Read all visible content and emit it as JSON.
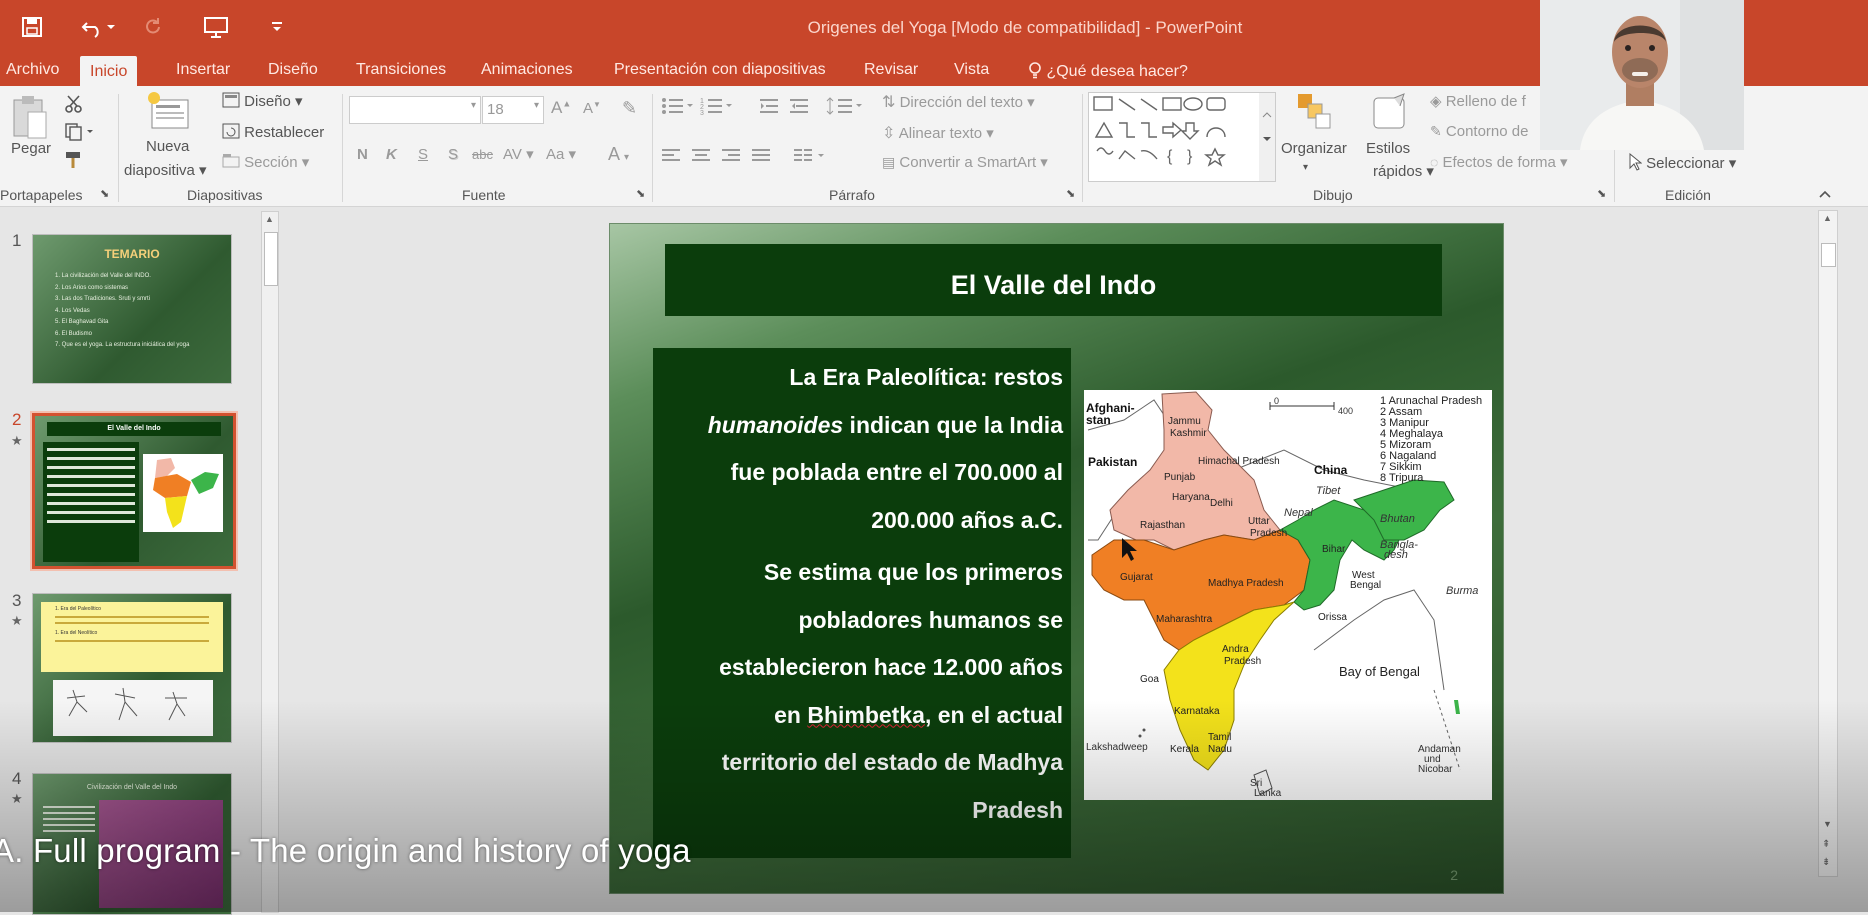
{
  "window": {
    "title": "Origenes del Yoga [Modo de compatibilidad] - PowerPoint"
  },
  "quick_access": {
    "save_icon": "save-icon",
    "undo_icon": "undo-icon",
    "redo_icon": "redo-icon",
    "present_icon": "presentation-icon",
    "customize_icon": "customize-qat-icon"
  },
  "tabs": [
    "Archivo",
    "Inicio",
    "Insertar",
    "Diseño",
    "Transiciones",
    "Animaciones",
    "Presentación con diapositivas",
    "Revisar",
    "Vista",
    "¿Qué desea hacer?"
  ],
  "active_tab": "Inicio",
  "ribbon": {
    "portapapeles": {
      "label": "Portapapeles",
      "pegar": "Pegar"
    },
    "diapositivas": {
      "label": "Diapositivas",
      "nueva_1": "Nueva",
      "nueva_2": "diapositiva",
      "diseno": "Diseño",
      "restablecer": "Restablecer",
      "seccion": "Sección"
    },
    "fuente": {
      "label": "Fuente",
      "font_name": "",
      "font_size": "18",
      "bold": "N",
      "italic": "K",
      "underline": "S",
      "shadow": "S",
      "strike": "abc",
      "spacing": "AV",
      "case": "Aa",
      "color": "A"
    },
    "parrafo": {
      "label": "Párrafo",
      "direccion": "Dirección del texto",
      "alinear": "Alinear texto",
      "smartart": "Convertir a SmartArt"
    },
    "dibujo": {
      "label": "Dibujo",
      "organizar": "Organizar",
      "estilos_1": "Estilos",
      "estilos_2": "rápidos",
      "relleno": "Relleno de f",
      "contorno": "Contorno de",
      "efectos": "Efectos de forma"
    },
    "edicion": {
      "label": "Edición",
      "seleccionar": "Seleccionar"
    }
  },
  "thumbnails": [
    {
      "number": "1",
      "title": "TEMARIO",
      "lines": [
        "1. La civilización del Valle del INDO.",
        "2. Los Arios como sistemas",
        "3. Las dos Tradiciones. Sruti y smrti",
        "4. Los Vedas",
        "5. El Baghavad Gita",
        "6. El Budismo",
        "7. Que es el yoga. La estructura iniciática del yoga"
      ]
    },
    {
      "number": "2",
      "star": "★",
      "title": "El Valle del Indo",
      "selected": true
    },
    {
      "number": "3",
      "star": "★",
      "title": "1. Era del Paleolítico",
      "title2": "1. Era del Neolítico"
    },
    {
      "number": "4",
      "star": "★",
      "title": "Civilización del Valle del Indo"
    }
  ],
  "slide": {
    "title": "El Valle del Indo",
    "para1_a": "La Era Paleolítica: restos",
    "para1_italic": "humanoides",
    "para1_b": " indican que la India",
    "para1_c": "fue poblada entre el  700.000 al",
    "para1_d": "200.000 años a.C.",
    "para2_a": "Se estima que los primeros",
    "para2_b": "pobladores humanos se",
    "para2_c": "establecieron   hace 12.000 años",
    "para2_d_pre": "en ",
    "para2_d_link": "Bhimbetka",
    "para2_d_post": ", en el actual",
    "para2_e": "territorio del estado de Madhya",
    "para2_f": "Pradesh",
    "page_number": "2",
    "map": {
      "scale_0": "0",
      "scale_400": "400",
      "country_labels": [
        "Afghani-",
        "stan",
        "Pakistan",
        "China",
        "Tibet",
        "Nepal",
        "Bhutan",
        "Bangla-",
        "desh",
        "Burma",
        "Bay of Bengal",
        "Sri",
        "Lanka",
        "Lakshadweep",
        "Andaman",
        "und",
        "Nicobar"
      ],
      "state_labels": [
        "Jammu",
        "Kashmir",
        "Himachal Pradesh",
        "Punjab",
        "Haryana",
        "Delhi",
        "Uttar",
        "Pradesh",
        "Rajasthan",
        "Bihar",
        "Gujarat",
        "Madhya Pradesh",
        "West",
        "Bengal",
        "Orissa",
        "Maharashtra",
        "Andra",
        "Pradesh",
        "Goa",
        "Karnataka",
        "Kerala",
        "Tamil",
        "Nadu"
      ],
      "legend": [
        "1 Arunachal Pradesh",
        "2 Assam",
        "3 Manipur",
        "4 Meghalaya",
        "5 Mizoram",
        "6 Nagaland",
        "7 Sikkim",
        "8 Tripura"
      ],
      "colors": {
        "north": "#f2b8a8",
        "central": "#f07f24",
        "east": "#3cb54a",
        "south": "#f3e21b"
      }
    }
  },
  "caption": "A. Full program - The origin and history of yoga",
  "webcam": {
    "name": "presenter-video"
  }
}
